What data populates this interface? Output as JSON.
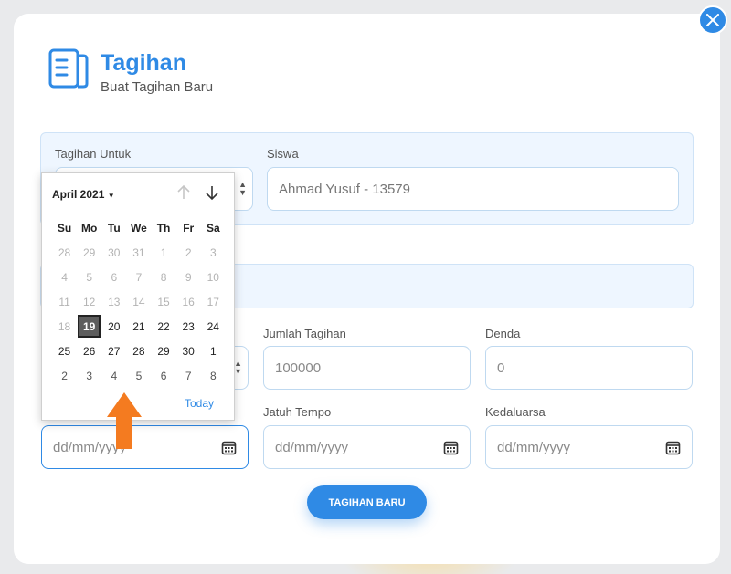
{
  "header": {
    "title": "Tagihan",
    "subtitle": "Buat Tagihan Baru"
  },
  "form": {
    "tagihan_untuk_label": "Tagihan Untuk",
    "siswa_label": "Siswa",
    "siswa_value": "Ahmad Yusuf - 13579",
    "jumlah_label": "Jumlah Tagihan",
    "jumlah_placeholder": "100000",
    "denda_label": "Denda",
    "denda_placeholder": "0",
    "jatuh_tempo_label": "Jatuh Tempo",
    "kedaluarsa_label": "Kedaluarsa",
    "date_placeholder": "dd/mm/yyyy",
    "submit_label": "TAGIHAN BARU"
  },
  "calendar": {
    "month_label": "April 2021",
    "weekdays": [
      "Su",
      "Mo",
      "Tu",
      "We",
      "Th",
      "Fr",
      "Sa"
    ],
    "weeks": [
      [
        [
          "28",
          "dim"
        ],
        [
          "29",
          "dim"
        ],
        [
          "30",
          "dim"
        ],
        [
          "31",
          "dim"
        ],
        [
          "1",
          "dim"
        ],
        [
          "2",
          "dim"
        ],
        [
          "3",
          "dim"
        ]
      ],
      [
        [
          "4",
          "dim"
        ],
        [
          "5",
          "dim"
        ],
        [
          "6",
          "dim"
        ],
        [
          "7",
          "dim"
        ],
        [
          "8",
          "dim"
        ],
        [
          "9",
          "dim"
        ],
        [
          "10",
          "dim"
        ]
      ],
      [
        [
          "11",
          "dim"
        ],
        [
          "12",
          "dim"
        ],
        [
          "13",
          "dim"
        ],
        [
          "14",
          "dim"
        ],
        [
          "15",
          "dim"
        ],
        [
          "16",
          "dim"
        ],
        [
          "17",
          "dim"
        ]
      ],
      [
        [
          "18",
          "dim"
        ],
        [
          "19",
          "sel"
        ],
        [
          "20",
          ""
        ],
        [
          "21",
          ""
        ],
        [
          "22",
          ""
        ],
        [
          "23",
          ""
        ],
        [
          "24",
          ""
        ]
      ],
      [
        [
          "25",
          ""
        ],
        [
          "26",
          ""
        ],
        [
          "27",
          ""
        ],
        [
          "28",
          ""
        ],
        [
          "29",
          ""
        ],
        [
          "30",
          ""
        ],
        [
          "1",
          ""
        ]
      ],
      [
        [
          "2",
          "other"
        ],
        [
          "3",
          "other"
        ],
        [
          "4",
          "other"
        ],
        [
          "5",
          "other"
        ],
        [
          "6",
          "other"
        ],
        [
          "7",
          "other"
        ],
        [
          "8",
          "other"
        ]
      ]
    ],
    "today_label": "Today"
  },
  "colors": {
    "accent": "#2f8ae5",
    "arrow": "#f47b20",
    "selected_day": "#5d5d5d"
  }
}
